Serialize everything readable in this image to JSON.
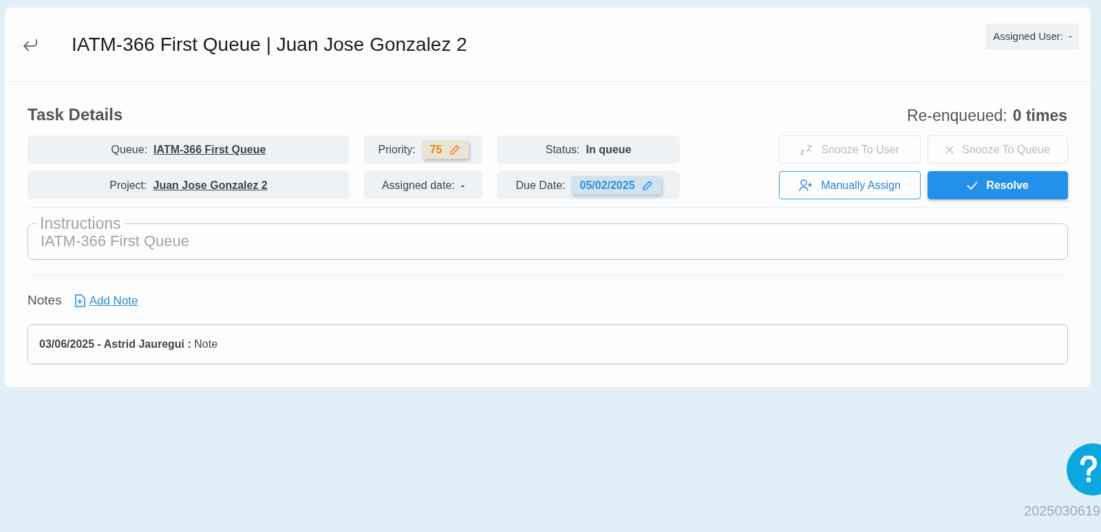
{
  "header": {
    "title": "IATM-366 First Queue | Juan Jose Gonzalez 2",
    "assigned_user": {
      "label": "Assigned User:",
      "value": "-"
    }
  },
  "task_details": {
    "heading": "Task Details",
    "reenqueued": {
      "label": "Re-enqueued:",
      "value": "0 times"
    },
    "fields": [
      {
        "kind": "link",
        "label": "Queue:",
        "value": "IATM-366 First Queue"
      },
      {
        "kind": "chip",
        "label": "Priority:",
        "value": "75",
        "color": "#e08a1e"
      },
      {
        "kind": "plain",
        "label": "Status:",
        "value": "In queue"
      },
      {
        "kind": "link",
        "label": "Project:",
        "value": "Juan Jose Gonzalez 2"
      },
      {
        "kind": "plain",
        "label": "Assigned date:",
        "value": "-"
      },
      {
        "kind": "chip",
        "label": "Due Date:",
        "value": "05/02/2025",
        "color": "#2b8fdc"
      }
    ],
    "buttons": [
      {
        "kind": "snooze",
        "label": "Snooze To User",
        "disabled": true
      },
      {
        "kind": "dismiss",
        "label": "Snooze To Queue",
        "disabled": true
      },
      {
        "kind": "assign",
        "label": "Manually Assign",
        "disabled": false
      },
      {
        "kind": "resolve",
        "label": "Resolve",
        "disabled": false
      }
    ]
  },
  "instructions": {
    "legend": "Instructions",
    "value": "IATM-366 First Queue"
  },
  "notes": {
    "heading": "Notes",
    "add_label": "Add Note",
    "items": [
      {
        "text": "**03/06/2025 - Astrid Jauregui :** Note"
      }
    ]
  },
  "footer": {
    "version": "2025030619"
  }
}
